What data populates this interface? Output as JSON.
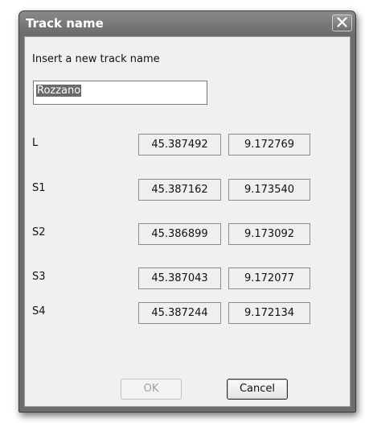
{
  "window": {
    "title": "Track name",
    "close_icon": "close-icon"
  },
  "form": {
    "prompt": "Insert a new track name",
    "name_value": "Rozzano"
  },
  "points": [
    {
      "label": "L",
      "lat": "45.387492",
      "lon": "9.172769"
    },
    {
      "label": "S1",
      "lat": "45.387162",
      "lon": "9.173540"
    },
    {
      "label": "S2",
      "lat": "45.386899",
      "lon": "9.173092"
    },
    {
      "label": "S3",
      "lat": "45.387043",
      "lon": "9.172077"
    },
    {
      "label": "S4",
      "lat": "45.387244",
      "lon": "9.172134"
    }
  ],
  "buttons": {
    "ok": "OK",
    "cancel": "Cancel"
  },
  "colors": {
    "titlebar": "#7a7a7a",
    "client_bg": "#f0f0f0"
  }
}
